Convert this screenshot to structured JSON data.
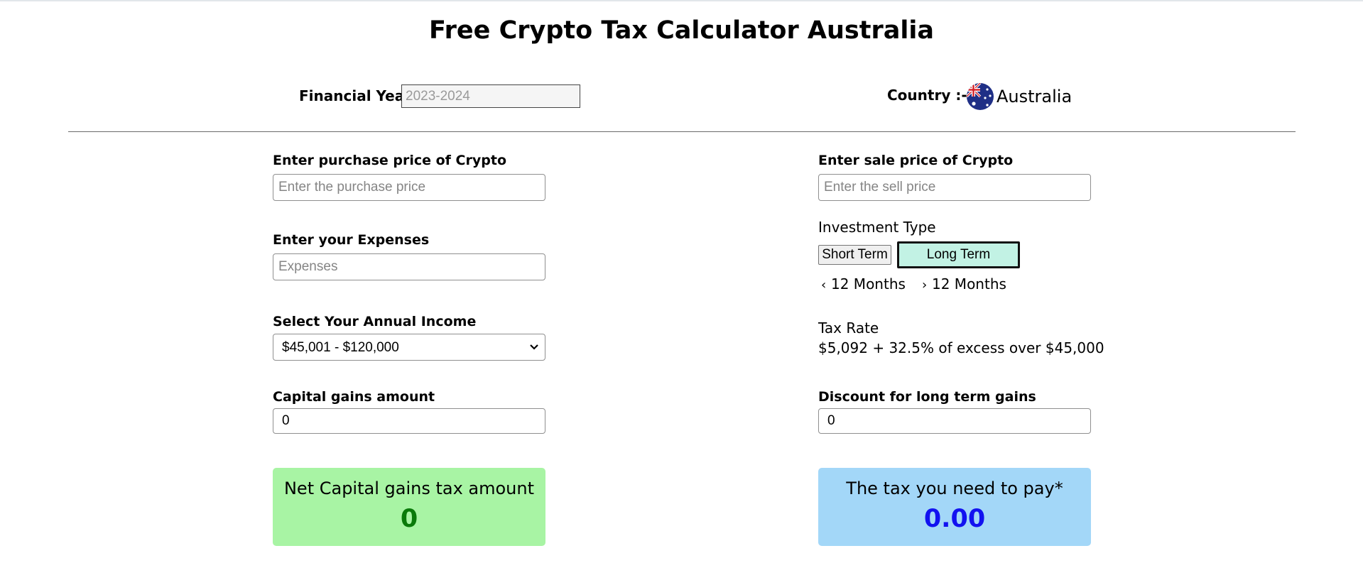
{
  "page": {
    "title": "Free Crypto Tax Calculator Australia"
  },
  "header": {
    "financial_year_label": "Financial Year",
    "financial_year_placeholder": "2023-2024",
    "country_label": "Country :-",
    "country_name": "Australia",
    "flag_icon": "australia-flag-icon"
  },
  "left": {
    "purchase_label": "Enter purchase price of Crypto",
    "purchase_placeholder": "Enter the purchase price",
    "expenses_label": "Enter your Expenses",
    "expenses_placeholder": "Expenses",
    "income_label": "Select Your Annual Income",
    "income_selected": "$45,001 - $120,000",
    "capital_gains_label": "Capital gains amount",
    "capital_gains_value": "0"
  },
  "right": {
    "sale_label": "Enter sale price of Crypto",
    "sale_placeholder": "Enter the sell price",
    "investment_type_label": "Investment Type",
    "short_term_label": "Short Term",
    "long_term_label": "Long Term",
    "short_term_note": "12 Months",
    "long_term_note": "12 Months",
    "tax_rate_label": "Tax Rate",
    "tax_rate_text": "$5,092 + 32.5% of excess over $45,000",
    "discount_label": "Discount for long term gains",
    "discount_value": "0"
  },
  "results": {
    "net_label": "Net Capital gains tax amount",
    "net_value": "0",
    "pay_label": "The tax you need to pay*",
    "pay_value": "0.00"
  },
  "colors": {
    "net_card_bg": "#a8f4a4",
    "net_value": "#0a7a0a",
    "pay_card_bg": "#a3d7f8",
    "pay_value": "#1212f0",
    "long_term_active_bg": "#c2f2e4"
  }
}
